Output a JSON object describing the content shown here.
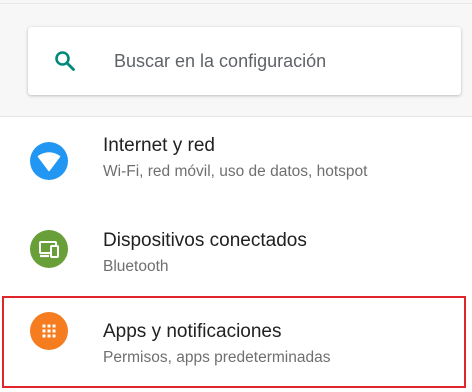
{
  "search": {
    "placeholder": "Buscar en la configuración",
    "icon": "search-icon"
  },
  "settings": [
    {
      "title": "Internet y red",
      "subtitle": "Wi-Fi, red móvil, uso de datos, hotspot",
      "icon": "wifi-icon",
      "icon_color": "#2196f3"
    },
    {
      "title": "Dispositivos conectados",
      "subtitle": "Bluetooth",
      "icon": "connected-devices-icon",
      "icon_color": "#689f38"
    },
    {
      "title": "Apps y notificaciones",
      "subtitle": "Permisos, apps predeterminadas",
      "icon": "apps-grid-icon",
      "icon_color": "#f57c1f",
      "highlighted": true
    }
  ],
  "colors": {
    "accent": "#00897b",
    "highlight_border": "#e0252d"
  }
}
